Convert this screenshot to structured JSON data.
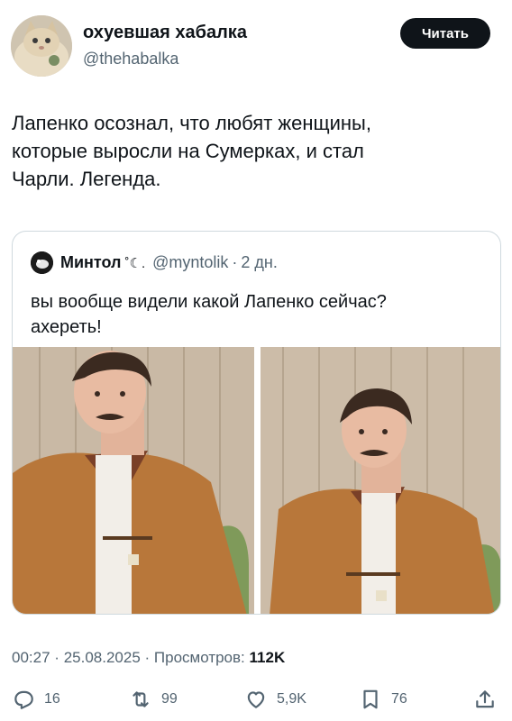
{
  "author": {
    "name": "охуевшая хабалка",
    "handle": "@thehabalka",
    "avatar_icon": "cat-avatar"
  },
  "follow_label": "Читать",
  "tweet_lines": [
    "Лапенко осознал, что любят женщины,",
    "которые выросли на Сумерках, и стал",
    "Чарли. Легенда."
  ],
  "quote": {
    "name": "Минтол",
    "emoji": "˚☾.",
    "handle": "@myntolik",
    "separator": "·",
    "time": "2 дн.",
    "text_lines": [
      "вы вообще видели какой Лапенко сейчас?",
      "ахереть!"
    ],
    "photos": [
      "photo-man-orange-jacket-1",
      "photo-man-orange-jacket-2"
    ]
  },
  "meta": {
    "time": "00:27",
    "date": "25.08.2025",
    "views_label": "Просмотров:",
    "views_count": "112K",
    "separator": "·"
  },
  "actions": {
    "replies": "16",
    "retweets": "99",
    "likes": "5,9K",
    "bookmarks": "76"
  },
  "colors": {
    "text_primary": "#0f1419",
    "text_secondary": "#536471",
    "border": "#cfd9de",
    "button_bg": "#0f1419"
  }
}
